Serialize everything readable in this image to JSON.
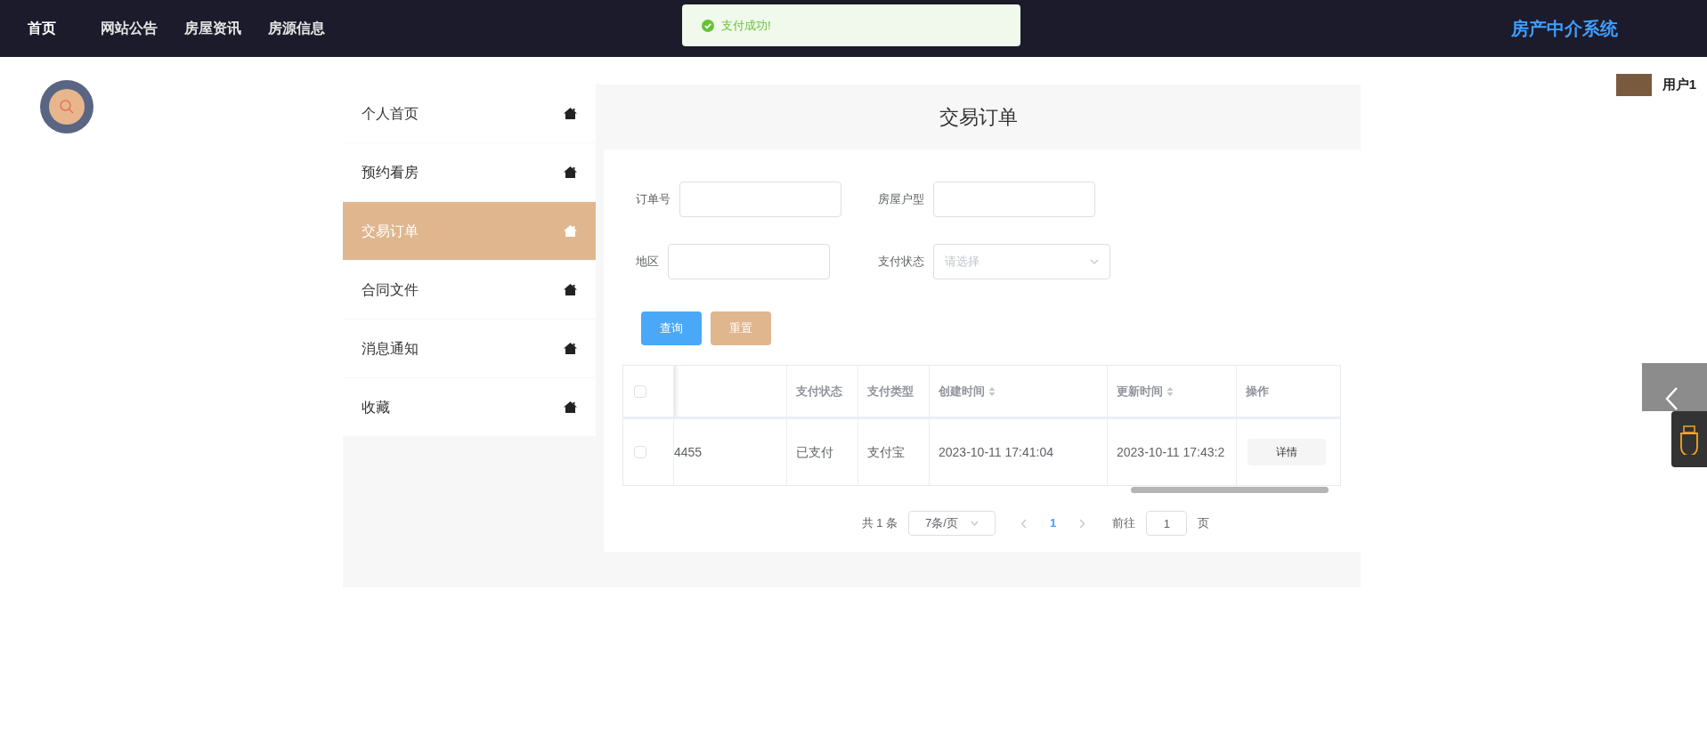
{
  "nav": [
    {
      "label": "首页",
      "selected": true
    },
    {
      "label": "网站公告",
      "selected": false
    },
    {
      "label": "房屋资讯",
      "selected": false
    },
    {
      "label": "房源信息",
      "selected": false
    }
  ],
  "toast": {
    "kind": "success",
    "text": "支付成功!"
  },
  "brand": "房产中介系统",
  "user": {
    "name": "用户1"
  },
  "sidebar": {
    "items": [
      {
        "label": "个人首页",
        "selected": false
      },
      {
        "label": "预约看房",
        "selected": false
      },
      {
        "label": "交易订单",
        "selected": true
      },
      {
        "label": "合同文件",
        "selected": false
      },
      {
        "label": "消息通知",
        "selected": false
      },
      {
        "label": "收藏",
        "selected": false
      }
    ]
  },
  "page_title": "交易订单",
  "filters": [
    {
      "kind": "input",
      "label": "订单号"
    },
    {
      "kind": "input",
      "label": "房屋户型"
    },
    {
      "kind": "input",
      "label": "地区"
    },
    {
      "kind": "select",
      "label": "支付状态",
      "placeholder": "请选择"
    }
  ],
  "buttons": [
    {
      "kind": "primary",
      "label": "查询"
    },
    {
      "kind": "secondary",
      "label": "重置"
    }
  ],
  "table": {
    "header_checked": false,
    "columns": [
      {
        "kind": "blank"
      },
      {
        "label": "支付状态",
        "sortable": false
      },
      {
        "label": "支付类型",
        "sortable": false
      },
      {
        "label": "创建时间",
        "sortable": true
      },
      {
        "label": "更新时间",
        "sortable": true
      },
      {
        "label": "操作",
        "sortable": false
      }
    ],
    "rows": [
      {
        "checked": false,
        "cells": [
          "4455",
          "已支付",
          "支付宝",
          "2023-10-11 17:41:04",
          "2023-10-11 17:43:2"
        ],
        "action": "详情"
      }
    ]
  },
  "pagination": {
    "total": "共 1 条",
    "page_size": "7条/页",
    "pages": [
      {
        "label": "1",
        "selected": true
      }
    ],
    "goto_label": "前往",
    "goto_value": "1",
    "page_suffix": "页"
  }
}
